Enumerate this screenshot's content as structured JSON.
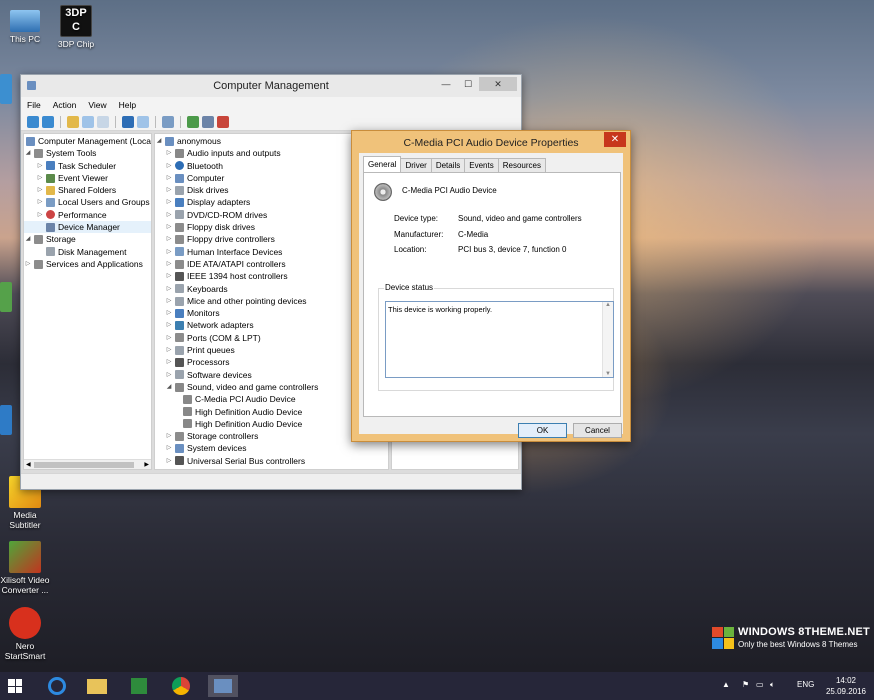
{
  "desktop_icons": [
    {
      "label": "This PC",
      "icon": "computer-icon"
    },
    {
      "label": "3DP Chip",
      "icon": "3dp-chip-icon",
      "logo_text": "3DP C"
    },
    {
      "label": "Media Subtitler",
      "icon": "media-subtitler-icon"
    },
    {
      "label": "Xilisoft Video Converter ...",
      "icon": "xilisoft-icon"
    },
    {
      "label": "Nero StartSmart",
      "icon": "nero-icon"
    }
  ],
  "cm": {
    "title": "Computer Management",
    "menu": [
      "File",
      "Action",
      "View",
      "Help"
    ],
    "left_tree": [
      "Computer Management (Local",
      "System Tools",
      "Task Scheduler",
      "Event Viewer",
      "Shared Folders",
      "Local Users and Groups",
      "Performance",
      "Device Manager",
      "Storage",
      "Disk Management",
      "Services and Applications"
    ],
    "device_tree": [
      "anonymous",
      "Audio inputs and outputs",
      "Bluetooth",
      "Computer",
      "Disk drives",
      "Display adapters",
      "DVD/CD-ROM drives",
      "Floppy disk drives",
      "Floppy drive controllers",
      "Human Interface Devices",
      "IDE ATA/ATAPI controllers",
      "IEEE 1394 host controllers",
      "Keyboards",
      "Mice and other pointing devices",
      "Monitors",
      "Network adapters",
      "Ports (COM & LPT)",
      "Print queues",
      "Processors",
      "Software devices",
      "Sound, video and game controllers",
      "C-Media PCI Audio Device",
      "High Definition Audio Device",
      "High Definition Audio Device",
      "Storage controllers",
      "System devices",
      "Universal Serial Bus controllers"
    ]
  },
  "dialog": {
    "title": "C-Media PCI Audio Device Properties",
    "tabs": [
      "General",
      "Driver",
      "Details",
      "Events",
      "Resources"
    ],
    "device_name": "C-Media PCI Audio Device",
    "device_type_label": "Device type:",
    "device_type": "Sound, video and game controllers",
    "manufacturer_label": "Manufacturer:",
    "manufacturer": "C-Media",
    "location_label": "Location:",
    "location": "PCI bus 3, device 7, function 0",
    "status_label": "Device status",
    "status_text": "This device is working properly.",
    "ok": "OK",
    "cancel": "Cancel"
  },
  "taskbar": {
    "apps": [
      "internet-explorer-icon",
      "file-explorer-icon",
      "store-icon",
      "chrome-icon",
      "computer-management-icon"
    ],
    "lang": "ENG",
    "time": "14:02",
    "date": "25.09.2016"
  },
  "watermark": {
    "line1": "WINDOWS 8THEME.NET",
    "line2": "Only the best Windows 8 Themes"
  },
  "colors": {
    "accent_orange": "#f0c27a",
    "close_red": "#c7361c",
    "selection": "#cce8ff"
  }
}
